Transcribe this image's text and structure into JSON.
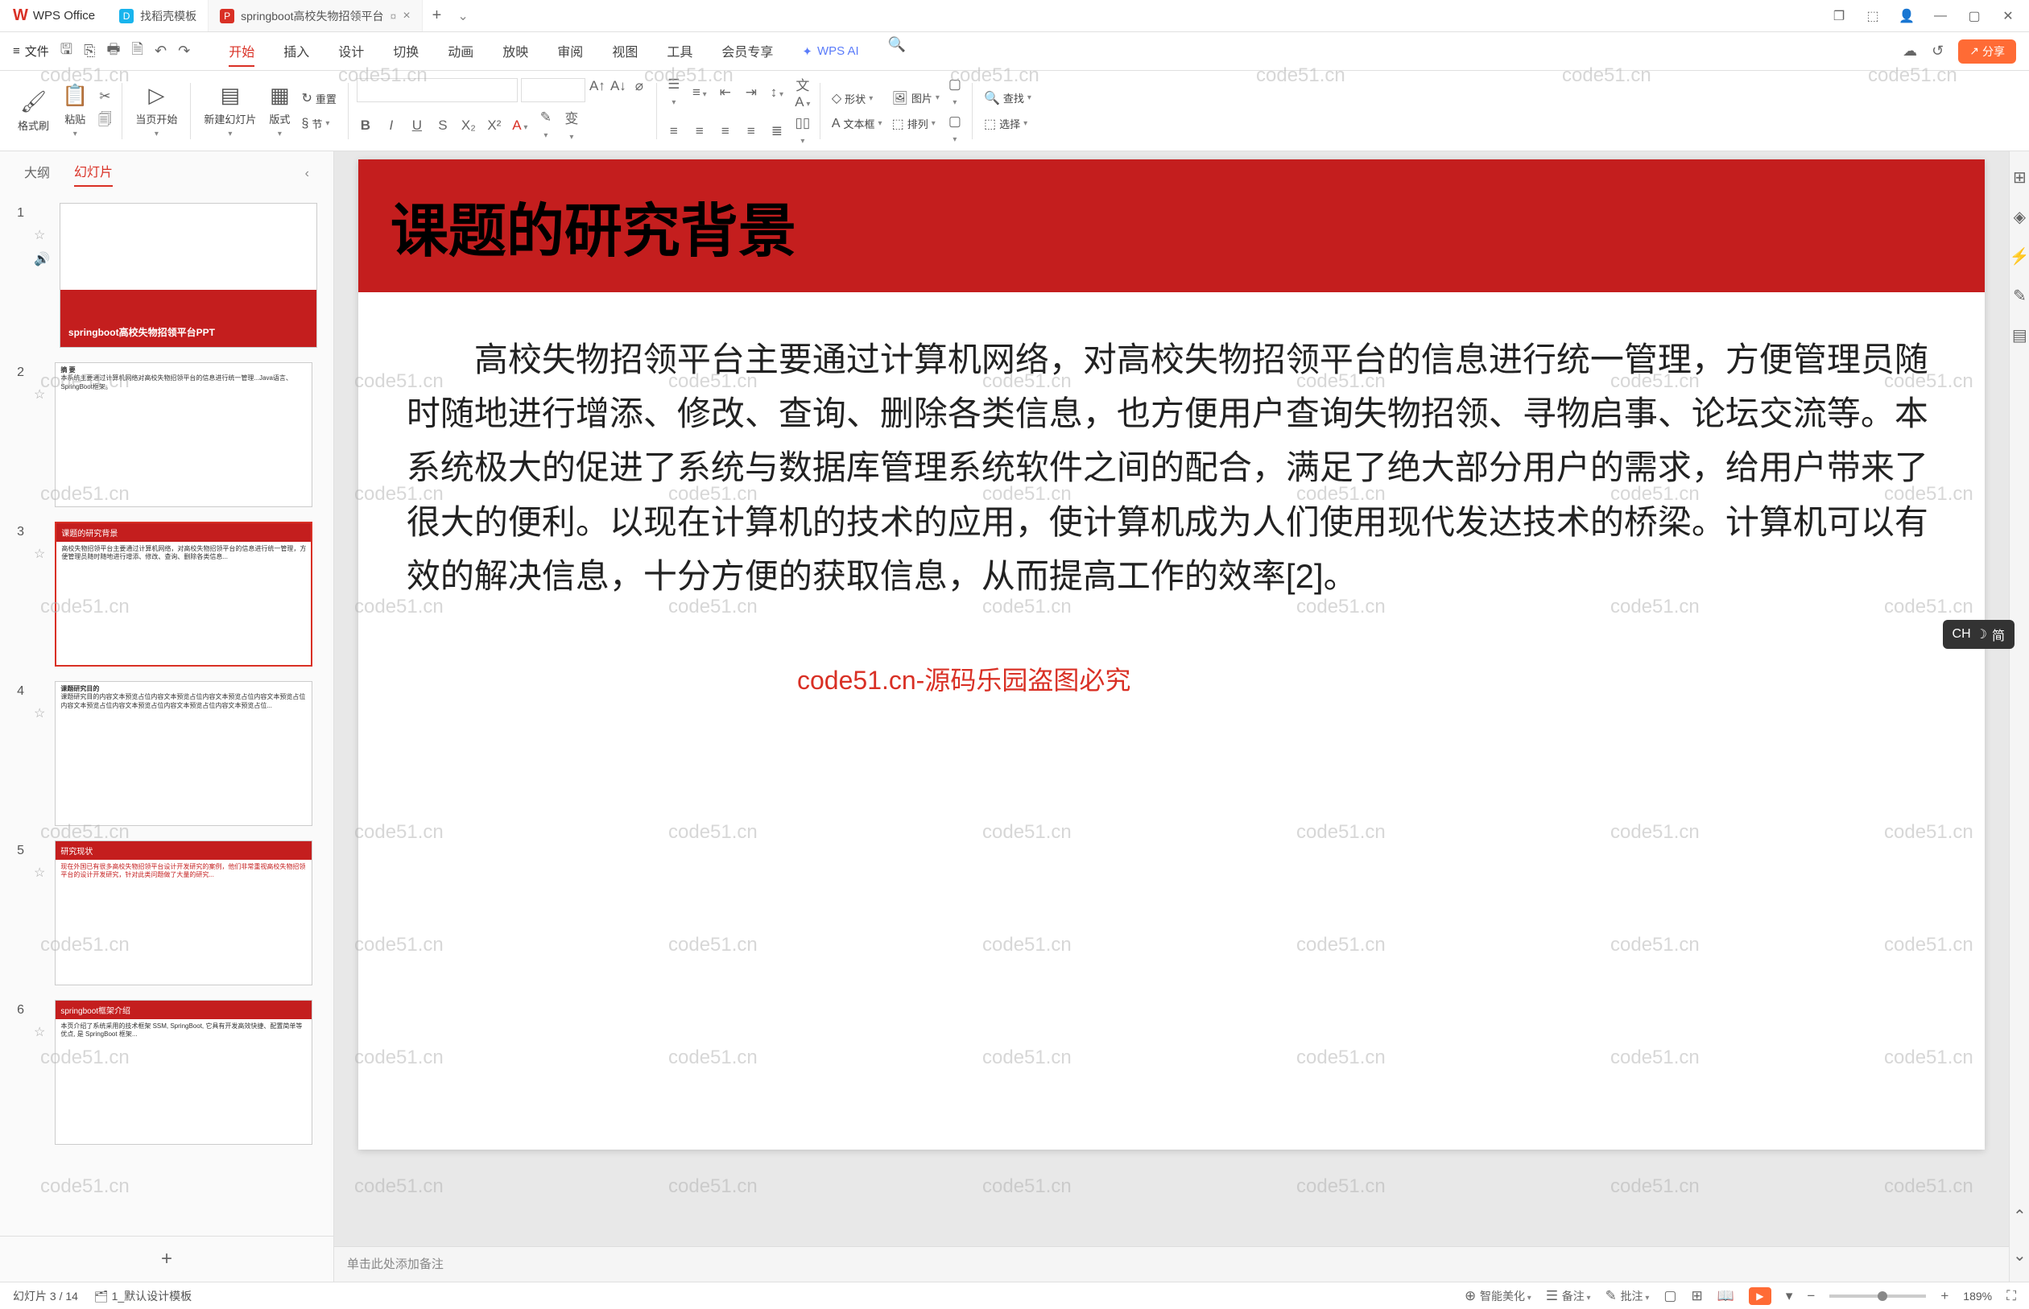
{
  "app": {
    "name": "WPS Office"
  },
  "tabs": [
    {
      "label": "找稻壳模板",
      "type": "docer"
    },
    {
      "label": "springboot高校失物招领平台",
      "type": "ppt",
      "active": true
    }
  ],
  "menu": {
    "file": "文件",
    "items": [
      "开始",
      "插入",
      "设计",
      "切换",
      "动画",
      "放映",
      "审阅",
      "视图",
      "工具",
      "会员专享"
    ],
    "active": "开始",
    "wps_ai": "WPS AI",
    "share": "分享"
  },
  "ribbon": {
    "format_brush": "格式刷",
    "paste": "粘贴",
    "from_current": "当页开始",
    "new_slide": "新建幻灯片",
    "layout": "版式",
    "section": "节",
    "reset": "重置",
    "text_dir": "文字方向",
    "shape": "形状",
    "textbox": "文本框",
    "picture": "图片",
    "arrange": "排列",
    "find": "查找",
    "select": "选择"
  },
  "sidebar": {
    "tabs": [
      "大纲",
      "幻灯片"
    ],
    "active": "幻灯片",
    "thumbs": [
      {
        "n": 1,
        "title": "springboot高校失物招领平台PPT"
      },
      {
        "n": 2,
        "title": "摘 要"
      },
      {
        "n": 3,
        "title": "课题的研究背景",
        "active": true
      },
      {
        "n": 4,
        "title": "课题研究目的"
      },
      {
        "n": 5,
        "title": "研究现状"
      },
      {
        "n": 6,
        "title": "springboot框架介绍"
      }
    ]
  },
  "slide": {
    "title": "课题的研究背景",
    "body": "高校失物招领平台主要通过计算机网络，对高校失物招领平台的信息进行统一管理，方便管理员随时随地进行增添、修改、查询、删除各类信息，也方便用户查询失物招领、寻物启事、论坛交流等。本系统极大的促进了系统与数据库管理系统软件之间的配合，满足了绝大部分用户的需求，给用户带来了很大的便利。以现在计算机的技术的应用，使计算机成为人们使用现代发达技术的桥梁。计算机可以有效的解决信息，十分方便的获取信息，从而提高工作的效率[2]。"
  },
  "notes": {
    "placeholder": "单击此处添加备注"
  },
  "status": {
    "slide_info": "幻灯片 3 / 14",
    "template": "1_默认设计模板",
    "smart_beautify": "智能美化",
    "notes_btn": "备注",
    "comments_btn": "批注",
    "zoom": "189%"
  },
  "ime": {
    "lang": "CH",
    "mode": "简"
  },
  "watermark_center": "code51.cn-源码乐园盗图必究"
}
